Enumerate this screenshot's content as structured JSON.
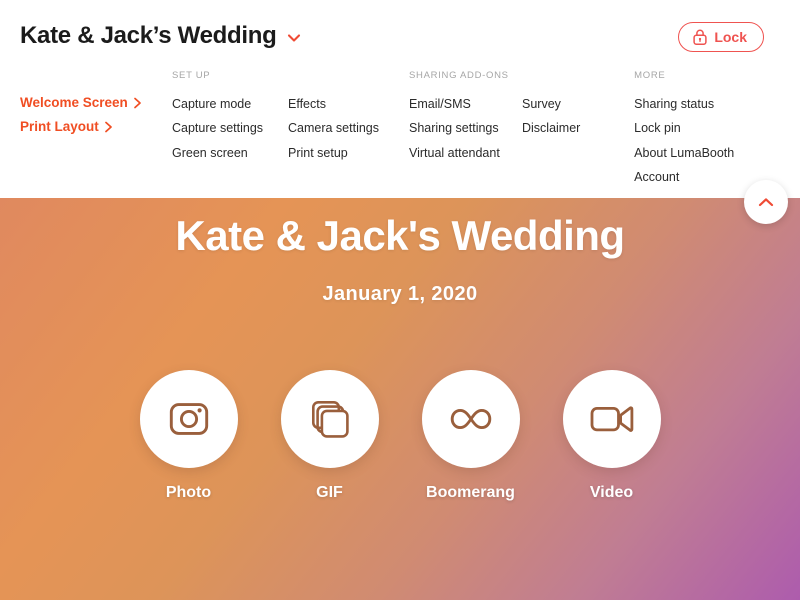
{
  "header": {
    "app_title": "Kate & Jack’s Wedding",
    "title_dropdown_icon": "chevron-down-icon",
    "lock_button": {
      "label": "Lock",
      "icon": "lock-icon",
      "color": "#ef5350"
    },
    "accent_color": "#f04e23",
    "quick_links": [
      {
        "label": "Welcome Screen",
        "icon": "chevron-right-icon"
      },
      {
        "label": "Print Layout",
        "icon": "chevron-right-icon"
      }
    ],
    "groups": [
      {
        "heading": "SET UP",
        "columns": [
          [
            "Capture mode",
            "Capture settings",
            "Green screen"
          ],
          [
            "Effects",
            "Camera settings",
            "Print setup"
          ]
        ]
      },
      {
        "heading": "SHARING ADD-ONS",
        "columns": [
          [
            "Email/SMS",
            "Sharing settings",
            "Virtual attendant"
          ],
          [
            "Survey",
            "Disclaimer"
          ]
        ]
      },
      {
        "heading": "MORE",
        "columns": [
          [
            "Sharing status",
            "Lock pin",
            "About LumaBooth",
            "Account"
          ]
        ]
      }
    ]
  },
  "stage": {
    "event_title": "Kate & Jack's Wedding",
    "event_date": "January 1, 2020",
    "background_colors": {
      "top_left": "#e0895f",
      "mid": "#e59456",
      "bottom_left": "#d4808f",
      "bottom_right": "#ad5cad"
    },
    "modes": [
      {
        "label": "Photo",
        "icon": "camera-icon"
      },
      {
        "label": "GIF",
        "icon": "stacked-squares-icon"
      },
      {
        "label": "Boomerang",
        "icon": "infinity-icon"
      },
      {
        "label": "Video",
        "icon": "video-camera-icon"
      }
    ],
    "collapse_button": {
      "icon": "chevron-up-icon",
      "color": "#ef5350"
    }
  }
}
